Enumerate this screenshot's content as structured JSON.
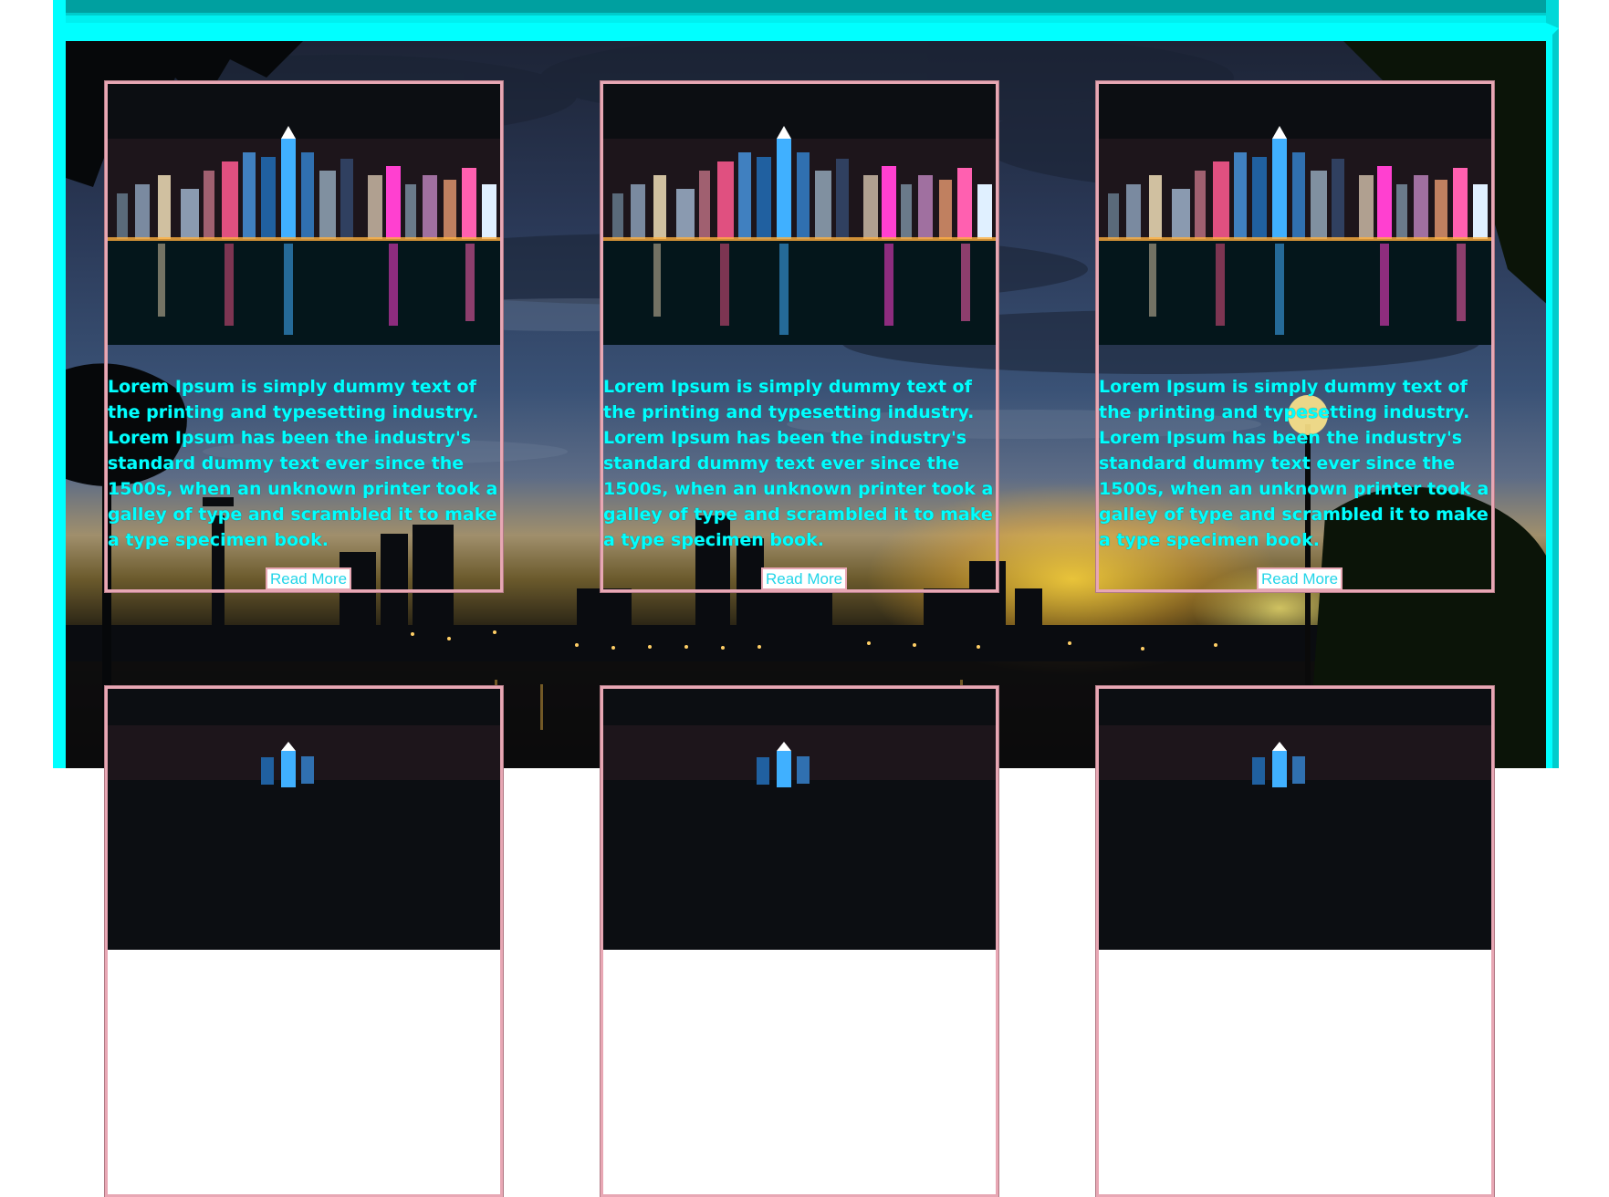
{
  "colors": {
    "frame_accent": "#00ffff",
    "card_border": "#e8a7b4",
    "text_accent": "#00ffff",
    "button_text": "#22d5e8"
  },
  "background": {
    "image": "night-city-skyline-park-icon"
  },
  "cards": [
    {
      "image": "city-skyline-night-icon",
      "text": "Lorem Ipsum is simply dummy text of the printing and typesetting industry. Lorem Ipsum has been the industry's standard dummy text ever since the 1500s, when an unknown printer took a galley of type and scrambled it to make a type specimen book.",
      "button_label": "Read More"
    },
    {
      "image": "city-skyline-night-icon",
      "text": "Lorem Ipsum is simply dummy text of the printing and typesetting industry. Lorem Ipsum has been the industry's standard dummy text ever since the 1500s, when an unknown printer took a galley of type and scrambled it to make a type specimen book.",
      "button_label": "Read More"
    },
    {
      "image": "city-skyline-night-icon",
      "text": "Lorem Ipsum is simply dummy text of the printing and typesetting industry. Lorem Ipsum has been the industry's standard dummy text ever since the 1500s, when an unknown printer took a galley of type and scrambled it to make a type specimen book.",
      "button_label": "Read More"
    },
    {
      "image": "city-skyline-night-icon"
    },
    {
      "image": "city-skyline-night-icon"
    },
    {
      "image": "city-skyline-night-icon"
    }
  ]
}
